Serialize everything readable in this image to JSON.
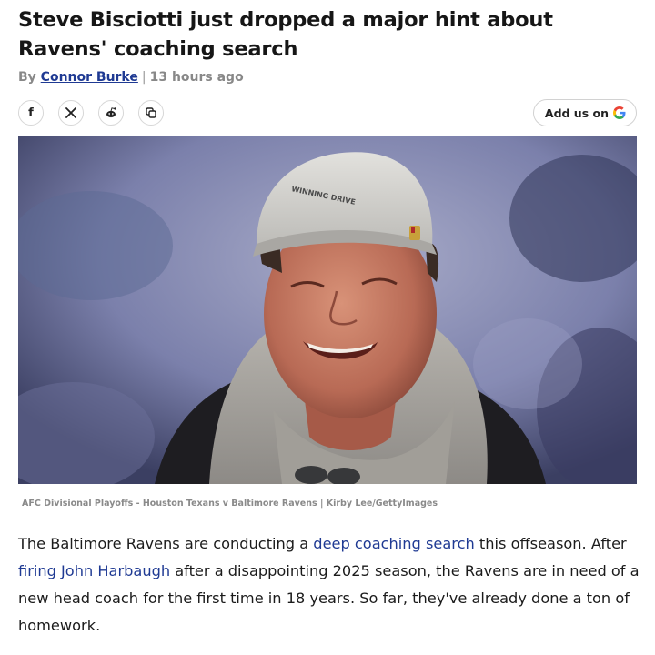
{
  "article": {
    "headline": "Steve Bisciotti just dropped a major hint about Ravens' coaching search",
    "byline": {
      "prefix": "By",
      "author": "Connor Burke",
      "separator": "|",
      "time": "13 hours ago"
    },
    "share": {
      "facebook_glyph": "f",
      "icons": [
        "facebook-icon",
        "x-icon",
        "reddit-icon",
        "copy-link-icon"
      ]
    },
    "add_us": {
      "label": "Add us on",
      "icon": "google-icon"
    },
    "image": {
      "cap_text": "WINNING DRIVE",
      "caption": "AFC Divisional Playoffs - Houston Texans v Baltimore Ravens | Kirby Lee/GettyImages"
    },
    "body": {
      "t1": "The Baltimore Ravens are conducting a ",
      "link1": "deep coaching search",
      "t2": " this offseason. After ",
      "link2": "firing John Harbaugh",
      "t3": " after a disappointing 2025 season, the Ravens are in need of a new head coach for the first time in 18 years. So far, they've already done a ton of homework."
    }
  }
}
